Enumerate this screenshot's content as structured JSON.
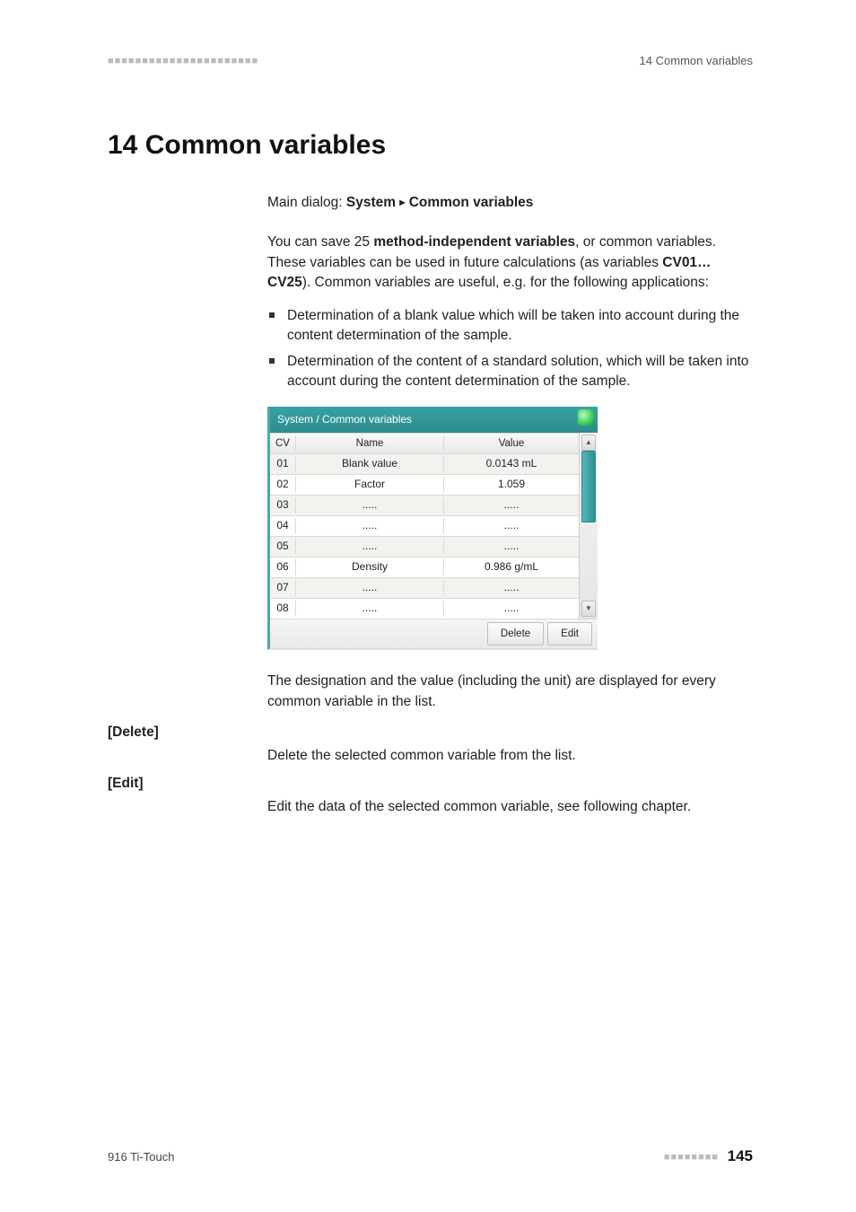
{
  "header": {
    "right": "14 Common variables"
  },
  "title": "14 Common variables",
  "breadcrumb": {
    "lead": "Main dialog: ",
    "part1": "System",
    "part2": "Common variables"
  },
  "intro": {
    "t1": "You can save 25 ",
    "bold1": "method-independent variables",
    "t2": ", or common variables. These variables can be used in future calculations (as variables ",
    "bold2": "CV01…CV25",
    "t3": "). Common variables are useful, e.g. for the following applications:"
  },
  "bullets": [
    "Determination of a blank value which will be taken into account during the content determination of the sample.",
    "Determination of the content of a standard solution, which will be taken into account during the content determination of the sample."
  ],
  "ui": {
    "title": "System / Common variables",
    "columns": {
      "cv": "CV",
      "name": "Name",
      "value": "Value"
    },
    "rows": [
      {
        "cv": "01",
        "name": "Blank value",
        "value": "0.0143 mL"
      },
      {
        "cv": "02",
        "name": "Factor",
        "value": "1.059"
      },
      {
        "cv": "03",
        "name": ".....",
        "value": "....."
      },
      {
        "cv": "04",
        "name": ".....",
        "value": "....."
      },
      {
        "cv": "05",
        "name": ".....",
        "value": "....."
      },
      {
        "cv": "06",
        "name": "Density",
        "value": "0.986 g/mL"
      },
      {
        "cv": "07",
        "name": ".....",
        "value": "....."
      },
      {
        "cv": "08",
        "name": ".....",
        "value": "....."
      }
    ],
    "buttons": {
      "delete": "Delete",
      "edit": "Edit"
    }
  },
  "after_shot": "The designation and the value (including the unit) are displayed for every common variable in the list.",
  "defs": {
    "delete": {
      "label": "[Delete]",
      "text": "Delete the selected common variable from the list."
    },
    "edit": {
      "label": "[Edit]",
      "text": "Edit the data of the selected common variable, see following chapter."
    }
  },
  "footer": {
    "left": "916 Ti-Touch",
    "page": "145"
  }
}
